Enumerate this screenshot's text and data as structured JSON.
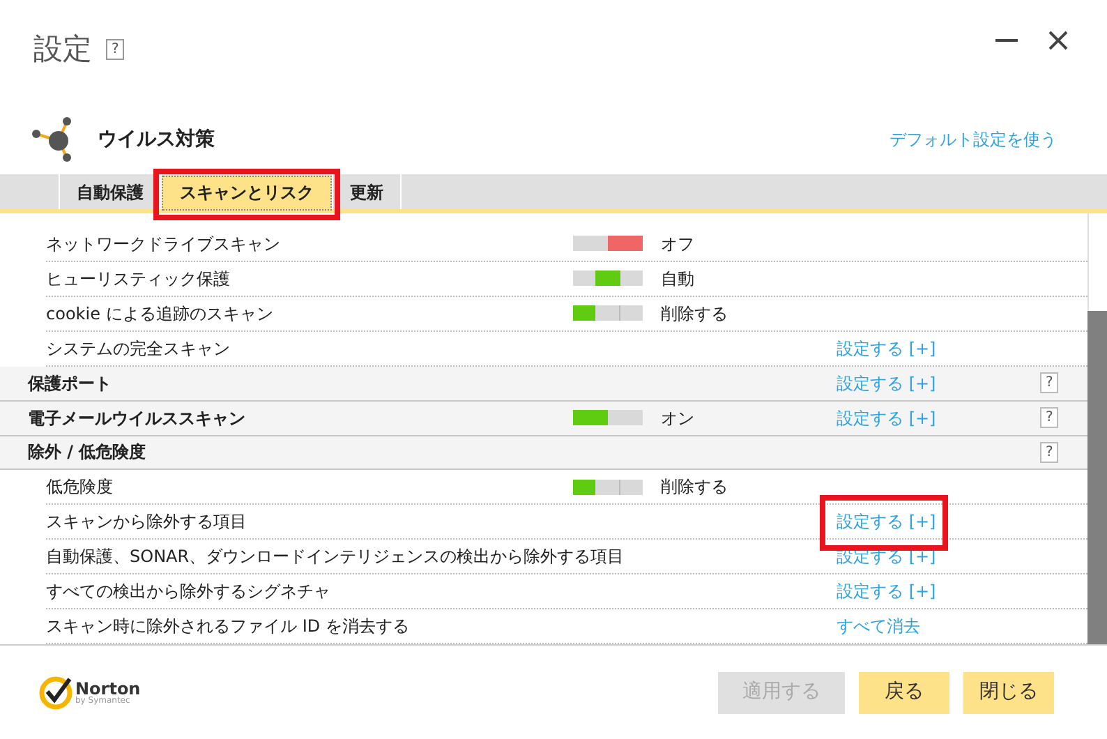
{
  "window": {
    "title": "設定",
    "help": "?"
  },
  "section": {
    "title": "ウイルス対策",
    "default_link": "デフォルト設定を使う"
  },
  "tabs": [
    {
      "label": "自動保護",
      "selected": false,
      "highlighted": false
    },
    {
      "label": "スキャンとリスク",
      "selected": true,
      "highlighted": true
    },
    {
      "label": "更新",
      "selected": false,
      "highlighted": false
    }
  ],
  "rows": [
    {
      "kind": "item",
      "label": "ネットワークドライブスキャン",
      "switch": {
        "kind": "off"
      },
      "status": "オフ"
    },
    {
      "kind": "item",
      "label": "ヒューリスティック保護",
      "switch": {
        "kind": "auto"
      },
      "status": "自動"
    },
    {
      "kind": "item",
      "label": "cookie による追跡のスキャン",
      "switch": {
        "kind": "remove"
      },
      "status": "削除する"
    },
    {
      "kind": "item",
      "label": "システムの完全スキャン",
      "link": "設定する [+]"
    },
    {
      "kind": "group",
      "label": "保護ポート",
      "link": "設定する [+]",
      "help": "?"
    },
    {
      "kind": "group",
      "label": "電子メールウイルススキャン",
      "switch": {
        "kind": "on"
      },
      "status": "オン",
      "link": "設定する [+]",
      "help": "?"
    },
    {
      "kind": "group",
      "label": "除外 / 低危険度",
      "help": "?"
    },
    {
      "kind": "item",
      "label": "低危険度",
      "switch": {
        "kind": "remove"
      },
      "status": "削除する"
    },
    {
      "kind": "item",
      "label": "スキャンから除外する項目",
      "link": "設定する [+]",
      "highlighted": true
    },
    {
      "kind": "item",
      "label": "自動保護、SONAR、ダウンロードインテリジェンスの検出から除外する項目",
      "link": "設定する [+]"
    },
    {
      "kind": "item",
      "label": "すべての検出から除外するシグネチャ",
      "link": "設定する [+]"
    },
    {
      "kind": "item",
      "label": "スキャン時に除外されるファイル ID を消去する",
      "link": "すべて消去"
    }
  ],
  "logo": {
    "name": "Norton",
    "sub": "by Symantec"
  },
  "buttons": [
    {
      "label": "適用する",
      "disabled": true
    },
    {
      "label": "戻る",
      "disabled": false
    },
    {
      "label": "閉じる",
      "disabled": false
    }
  ]
}
